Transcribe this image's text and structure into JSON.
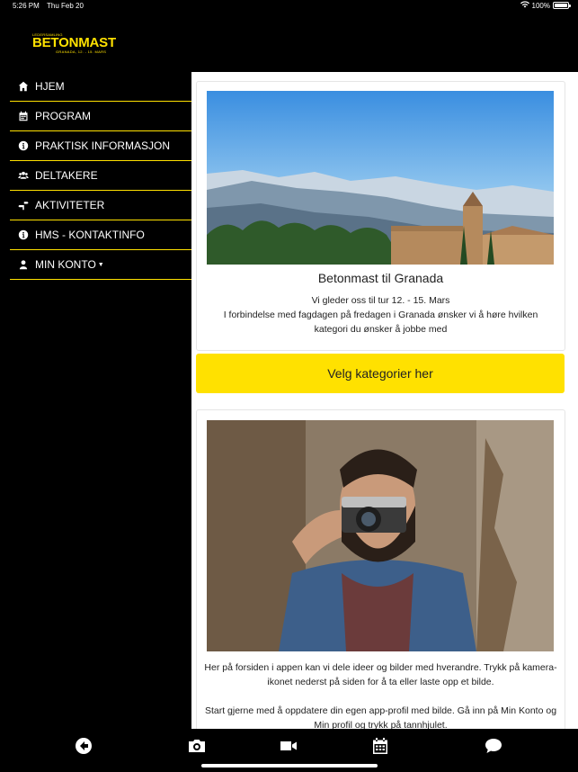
{
  "status": {
    "time": "5:26 PM",
    "date": "Thu Feb 20",
    "battery": "100%",
    "battery_level": 1.0
  },
  "logo": {
    "top": "LEDERSAMLING",
    "main": "BETONMAST",
    "sub": "GRANADA, 12. - 15. MARS"
  },
  "sidebar": {
    "items": [
      {
        "label": "HJEM",
        "icon": "home-icon"
      },
      {
        "label": "PROGRAM",
        "icon": "calendar-icon"
      },
      {
        "label": "PRAKTISK INFORMASJON",
        "icon": "info-circle-icon"
      },
      {
        "label": "DELTAKERE",
        "icon": "users-icon"
      },
      {
        "label": "AKTIVITETER",
        "icon": "signpost-icon"
      },
      {
        "label": "HMS - KONTAKTINFO",
        "icon": "info-circle-icon"
      },
      {
        "label": "MIN KONTO",
        "icon": "user-icon"
      }
    ]
  },
  "card1": {
    "image": "granada-alhambra-landscape",
    "title": "Betonmast til Granada",
    "text_line1": "Vi gleder oss til tur 12. - 15. Mars",
    "text_line2": "I forbindelse med fagdagen på fredagen i Granada ønsker vi å høre hvilken kategori du ønsker å jobbe med"
  },
  "cta": {
    "label": "Velg kategorier her"
  },
  "card2": {
    "image": "man-with-camera-photo",
    "para1": "Her på forsiden i appen kan vi dele ideer og bilder med hverandre. Trykk på kamera-ikonet nederst på siden for å ta eller laste opp et bilde.",
    "para2": "Start gjerne med å oppdatere din egen app-profil med bilde. Gå inn på Min Konto og Min profil og trykk på tannhjulet."
  },
  "tabbar": {
    "items": [
      "back-arrow-icon",
      "camera-icon",
      "video-camera-icon",
      "calendar-icon",
      "chat-bubble-icon"
    ]
  },
  "colors": {
    "accent": "#ffe100",
    "background": "#000000",
    "card": "#ffffff"
  }
}
